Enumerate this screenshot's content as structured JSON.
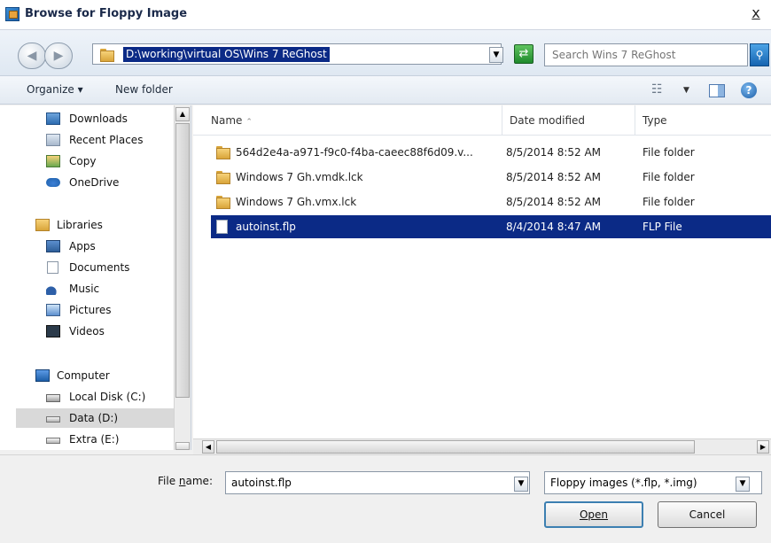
{
  "window": {
    "title": "Browse for Floppy Image",
    "close_glyph": "x"
  },
  "address_bar": {
    "path": "D:\\working\\virtual OS\\Wins 7 ReGhost",
    "search_placeholder": "Search Wins 7 ReGhost"
  },
  "toolbar": {
    "organize_label": "Organize ▾",
    "new_folder_label": "New folder"
  },
  "nav_pane": {
    "items": [
      {
        "label": "Downloads",
        "icon": "downloads-icon"
      },
      {
        "label": "Recent Places",
        "icon": "recent-places-icon"
      },
      {
        "label": "Copy",
        "icon": "copy-folder-icon"
      },
      {
        "label": "OneDrive",
        "icon": "onedrive-icon"
      },
      {
        "label": "Libraries",
        "icon": "libraries-icon"
      },
      {
        "label": "Apps",
        "icon": "apps-icon"
      },
      {
        "label": "Documents",
        "icon": "documents-icon"
      },
      {
        "label": "Music",
        "icon": "music-icon"
      },
      {
        "label": "Pictures",
        "icon": "pictures-icon"
      },
      {
        "label": "Videos",
        "icon": "videos-icon"
      },
      {
        "label": "Computer",
        "icon": "computer-icon"
      },
      {
        "label": "Local Disk (C:)",
        "icon": "local-disk-icon"
      },
      {
        "label": "Data (D:)",
        "icon": "drive-icon",
        "selected": true
      },
      {
        "label": "Extra (E:)",
        "icon": "drive-icon"
      }
    ]
  },
  "file_list": {
    "columns": {
      "name": "Name",
      "date": "Date modified",
      "type": "Type"
    },
    "rows": [
      {
        "name": "564d2e4a-a971-f9c0-f4ba-caeec88f6d09.v...",
        "date": "8/5/2014 8:52 AM",
        "type": "File folder",
        "icon": "folder-icon"
      },
      {
        "name": "Windows 7 Gh.vmdk.lck",
        "date": "8/5/2014 8:52 AM",
        "type": "File folder",
        "icon": "folder-icon"
      },
      {
        "name": "Windows 7 Gh.vmx.lck",
        "date": "8/5/2014 8:52 AM",
        "type": "File folder",
        "icon": "folder-icon"
      },
      {
        "name": "autoinst.flp",
        "date": "8/4/2014 8:47 AM",
        "type": "FLP File",
        "icon": "file-icon",
        "selected": true
      }
    ]
  },
  "footer": {
    "file_name_label_pre": "File ",
    "file_name_label_u": "n",
    "file_name_label_post": "ame:",
    "file_name_value": "autoinst.flp",
    "file_type_value": "Floppy images (*.flp, *.img)",
    "open_label": "Open",
    "cancel_label": "Cancel"
  },
  "colors": {
    "selection": "#0b2a86",
    "accent": "#3c7fb1"
  }
}
